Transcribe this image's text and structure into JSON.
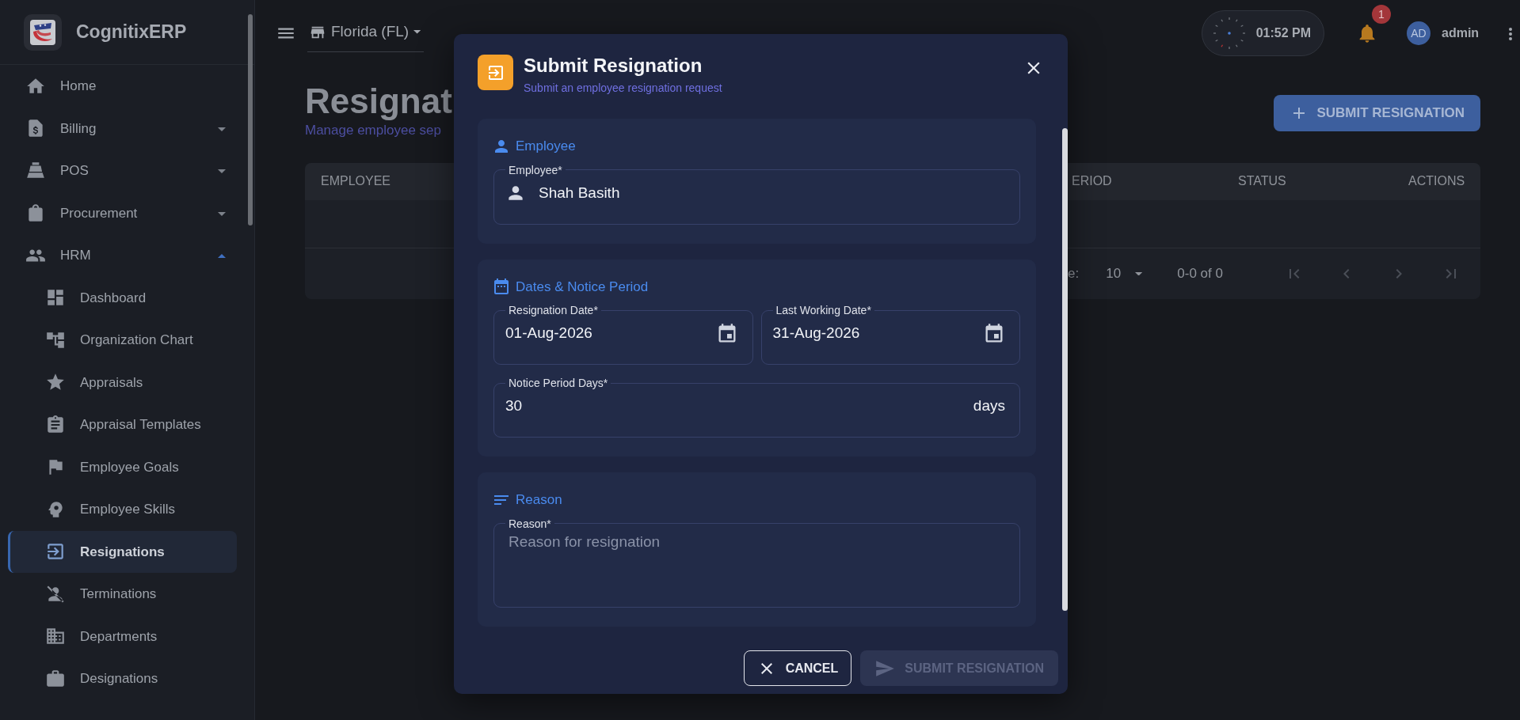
{
  "brand": {
    "name": "CognitixERP"
  },
  "sidebar": {
    "items": [
      {
        "label": "Home",
        "selected": false
      },
      {
        "label": "Billing",
        "selected": false,
        "expanded": false
      },
      {
        "label": "POS",
        "selected": false,
        "expanded": false
      },
      {
        "label": "Procurement",
        "selected": false,
        "expanded": false
      },
      {
        "label": "HRM",
        "selected": false,
        "expanded": true,
        "children": [
          {
            "label": "Dashboard",
            "selected": false
          },
          {
            "label": "Organization Chart",
            "selected": false
          },
          {
            "label": "Appraisals",
            "selected": false
          },
          {
            "label": "Appraisal Templates",
            "selected": false
          },
          {
            "label": "Employee Goals",
            "selected": false
          },
          {
            "label": "Employee Skills",
            "selected": false
          },
          {
            "label": "Resignations",
            "selected": true
          },
          {
            "label": "Terminations",
            "selected": false
          },
          {
            "label": "Departments",
            "selected": false
          },
          {
            "label": "Designations",
            "selected": false
          }
        ]
      }
    ]
  },
  "topbar": {
    "location": "Florida (FL)",
    "clock": "01:52 PM",
    "notifications": "1",
    "user": {
      "initials": "AD",
      "name": "admin"
    }
  },
  "page": {
    "title": "Resignat",
    "subtitle": "Manage employee sep",
    "action": "SUBMIT RESIGNATION",
    "table": {
      "columns": [
        "EMPLOYEE",
        "ERIOD",
        "STATUS",
        "ACTIONS"
      ],
      "pagination": {
        "rows_label": "e:",
        "rows_per_page": "10",
        "range": "0-0 of 0"
      }
    }
  },
  "modal": {
    "title": "Submit Resignation",
    "subtitle": "Submit an employee resignation request",
    "sections": [
      {
        "kind": "person",
        "heading": "Employee",
        "fields": [
          {
            "label": "Employee*",
            "value": "Shah Basith",
            "kind": "person"
          }
        ]
      },
      {
        "kind": "calendar",
        "heading": "Dates & Notice Period",
        "fields": [
          {
            "label": "Resignation Date*",
            "value": "01-Aug-2026",
            "kind": "date"
          },
          {
            "label": "Last Working Date*",
            "value": "31-Aug-2026",
            "kind": "date"
          },
          {
            "label": "Notice Period Days*",
            "value": "30",
            "suffix": "days",
            "kind": "number"
          }
        ]
      },
      {
        "kind": "lines",
        "heading": "Reason",
        "fields": [
          {
            "label": "Reason*",
            "placeholder": "Reason for resignation",
            "kind": "textarea"
          }
        ]
      }
    ],
    "buttons": [
      {
        "label": "CANCEL",
        "kind": "cancel",
        "disabled": false
      },
      {
        "label": "SUBMIT RESIGNATION",
        "kind": "submit",
        "disabled": true
      }
    ]
  }
}
